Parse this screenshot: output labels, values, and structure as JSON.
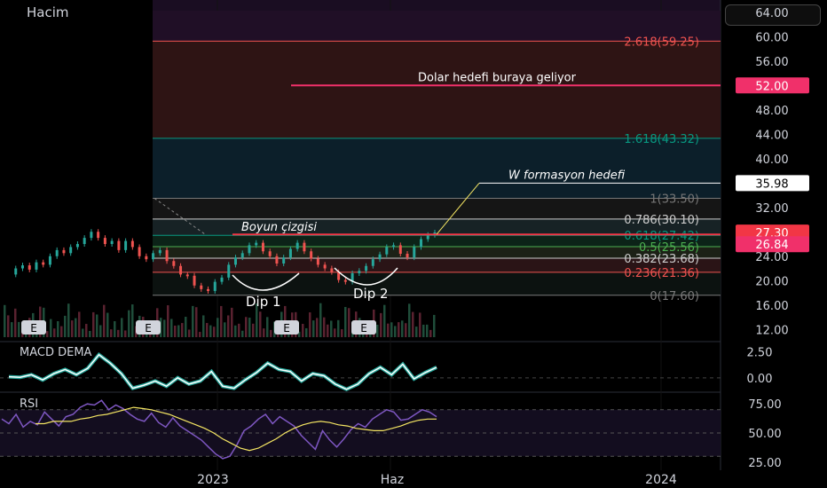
{
  "panel_titles": {
    "volume": "Hacim",
    "macd": "MACD DEMA",
    "rsi": "RSI"
  },
  "chart_data": [
    {
      "type": "line",
      "name": "price",
      "ylim": [
        10,
        66
      ],
      "y_ticks": [
        "12.00",
        "16.00",
        "20.00",
        "24.00",
        "28.00",
        "32.00",
        "36.00",
        "40.00",
        "44.00",
        "48.00",
        "52.00",
        "56.00",
        "60.00",
        "64.00"
      ],
      "x_ticks": [
        "2023",
        "Haz",
        "2024"
      ],
      "series": [
        {
          "values": [
            21,
            22,
            22.5,
            21.8,
            23,
            22.6,
            24,
            25,
            24.5,
            25.5,
            26,
            27,
            28,
            27,
            26,
            26.5,
            25,
            26.5,
            25.5,
            24,
            23.5,
            24.5,
            25,
            23.2,
            22.4,
            21,
            20.8,
            19.2,
            18.6,
            18.3,
            19.8,
            20.5,
            22.6,
            23.8,
            24.5,
            25.8,
            26.2,
            24.8,
            24,
            22.8,
            23.8,
            25.2,
            26.2,
            24.8,
            23.6,
            22.6,
            22,
            21.4,
            20.1,
            19.8,
            21.2,
            21.6,
            22.4,
            23.5,
            24.3,
            25.5,
            25.8,
            24.4,
            23.8,
            25.5,
            26.8,
            27.5,
            27.9
          ]
        }
      ],
      "fib_levels": [
        {
          "label": "0(17.60)",
          "value": 17.6,
          "color": "#7a7a7a",
          "fill": "#0c1210"
        },
        {
          "label": "0.236(21.36)",
          "value": 21.36,
          "color": "#ef5350",
          "fill": "#2a1416"
        },
        {
          "label": "0.382(23.68)",
          "value": 23.68,
          "color": "#cccccc",
          "fill": "#1c2116"
        },
        {
          "label": "0.5(25.56)",
          "value": 25.56,
          "color": "#4caf50",
          "fill": "#0c2318"
        },
        {
          "label": "0.618(27.42)",
          "value": 27.42,
          "color": "#089981",
          "fill": "#172225"
        },
        {
          "label": "0.786(30.10)",
          "value": 30.1,
          "color": "#cccccc",
          "fill": "#151515"
        },
        {
          "label": "1(33.50)",
          "value": 33.5,
          "color": "#777777",
          "fill": "#0c1f2a"
        },
        {
          "label": "1.618(43.32)",
          "value": 43.32,
          "color": "#089981",
          "fill": "#2e1414"
        },
        {
          "label": "2.618(59.25)",
          "value": 59.25,
          "color": "#ef5350",
          "fill": "#200f26"
        }
      ],
      "annotations": {
        "dollar_target": "Dolar hedefi buraya geliyor",
        "w_target": "W formasyon hedefi",
        "neckline": "Boyun çizgisi",
        "dip1": "Dip 1",
        "dip2": "Dip 2"
      },
      "price_tags": [
        {
          "text": "52.00",
          "value": 52.0,
          "bg": "#f0306a",
          "fg": "#ffffff"
        },
        {
          "text": "35.98",
          "value": 35.98,
          "bg": "#ffffff",
          "fg": "#000000"
        },
        {
          "text": "27.30",
          "value": 27.3,
          "bg": "#f23645",
          "fg": "#ffffff"
        },
        {
          "text": "26.84",
          "value": 26.84,
          "bg": "#f0306a",
          "fg": "#ffffff"
        }
      ],
      "earnings_markers": [
        "E",
        "E",
        "E",
        "E"
      ]
    },
    {
      "type": "line",
      "name": "MACD DEMA",
      "ylim": [
        -1.2,
        3.2
      ],
      "y_ticks": [
        "2.50",
        "0.00"
      ],
      "series": [
        {
          "values": [
            0.1,
            0.05,
            0.3,
            -0.2,
            0.4,
            0.8,
            0.3,
            0.9,
            2.2,
            1.4,
            0.4,
            -1.0,
            -0.7,
            -0.3,
            -0.8,
            0.0,
            -0.6,
            -0.3,
            0.6,
            -0.8,
            -1.0,
            -0.2,
            0.5,
            1.4,
            0.8,
            0.6,
            -0.3,
            0.4,
            0.2,
            -0.6,
            -1.1,
            -0.6,
            0.4,
            1.0,
            0.3,
            1.3,
            -0.1,
            0.5,
            1.0
          ]
        }
      ]
    },
    {
      "type": "line",
      "name": "RSI",
      "ylim": [
        18,
        82
      ],
      "y_ticks": [
        "75.00",
        "50.00",
        "25.00"
      ],
      "series": [
        {
          "values": [
            62,
            58,
            66,
            55,
            60,
            57,
            68,
            62,
            56,
            64,
            66,
            72,
            75,
            74,
            78,
            70,
            74,
            71,
            66,
            62,
            60,
            67,
            59,
            55,
            63,
            56,
            52,
            48,
            44,
            38,
            32,
            28,
            30,
            40,
            52,
            56,
            62,
            66,
            58,
            64,
            60,
            56,
            48,
            42,
            36,
            52,
            44,
            38,
            45,
            53,
            58,
            55,
            62,
            66,
            70,
            68,
            61,
            62,
            66,
            70,
            68,
            64
          ]
        },
        {
          "values": [
            58,
            58,
            60,
            60,
            60,
            62,
            63,
            65,
            66,
            68,
            70,
            72,
            71,
            70,
            68,
            66,
            63,
            60,
            57,
            54,
            50,
            45,
            41,
            37,
            35,
            37,
            41,
            45,
            50,
            54,
            57,
            59,
            60,
            59,
            57,
            56,
            54,
            53,
            52,
            52,
            54,
            56,
            59,
            61,
            62,
            62
          ]
        }
      ]
    }
  ]
}
